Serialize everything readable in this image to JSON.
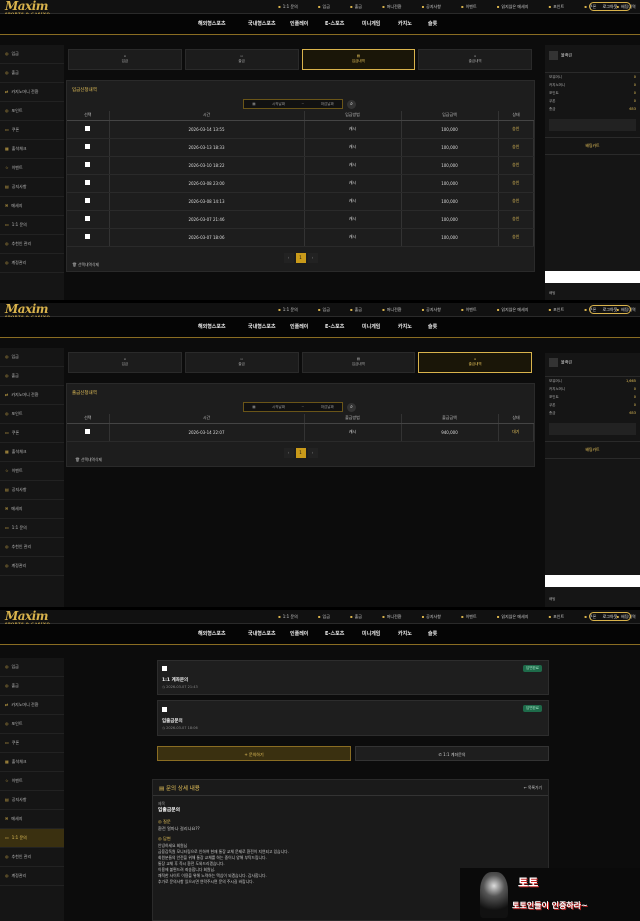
{
  "brand": {
    "name": "Maxim",
    "tagline": "SPORTS & CASINO"
  },
  "util_bar": [
    "1:1 문의",
    "입금",
    "출금",
    "머니전환",
    "공지사항",
    "이벤트",
    "읽지않은 메세지",
    "포인트",
    "쿠폰",
    "배팅내역"
  ],
  "login_label": "로그아웃",
  "nav": [
    "해외형스포츠",
    "국내형스포츠",
    "인플레이",
    "E-스포츠",
    "미니게임",
    "카지노",
    "슬롯"
  ],
  "sidebar": [
    "입금",
    "출금",
    "카지노머니 전환",
    "포인트",
    "쿠폰",
    "출석체크",
    "이벤트",
    "공지사항",
    "메세지",
    "1:1 문의",
    "추천인 관리",
    "계정관리"
  ],
  "tabs": [
    "입금",
    "출금",
    "입금내역",
    "출금내역"
  ],
  "deposit": {
    "title": "입금신청내역",
    "date_start": "시작날짜",
    "date_end": "마감날짜",
    "headers": [
      "선택",
      "시간",
      "입금방법",
      "입금금액",
      "상태"
    ],
    "rows": [
      [
        "2026-03-14 13:55",
        "캐시",
        "100,000",
        "승인"
      ],
      [
        "2026-03-13 18:33",
        "캐시",
        "100,000",
        "승인"
      ],
      [
        "2026-03-10 18:22",
        "캐시",
        "100,000",
        "승인"
      ],
      [
        "2026-03-08 23:00",
        "캐시",
        "100,000",
        "승인"
      ],
      [
        "2026-03-08 14:13",
        "캐시",
        "100,000",
        "승인"
      ],
      [
        "2026-03-07 21:46",
        "캐시",
        "100,000",
        "승인"
      ],
      [
        "2026-03-07 18:06",
        "캐시",
        "100,000",
        "승인"
      ]
    ],
    "delete_label": "선택내역삭제",
    "page": "1"
  },
  "withdraw": {
    "title": "출금신청내역",
    "date_start": "시작날짜",
    "date_end": "마감날짜",
    "headers": [
      "선택",
      "시간",
      "출금방법",
      "출금금액",
      "상태"
    ],
    "rows": [
      [
        "2026-03-14 22:07",
        "캐시",
        "940,000",
        "대기"
      ]
    ],
    "delete_label": "선택내역삭제",
    "page": "1"
  },
  "right_panel": {
    "user": "블랙린",
    "rows": [
      [
        "보유머니",
        "0"
      ],
      [
        "카지노머니",
        "0"
      ],
      [
        "포인트",
        "0"
      ],
      [
        "쿠폰",
        "0"
      ],
      [
        "총금",
        "653"
      ]
    ],
    "rows2": [
      [
        "보유머니",
        "1,665"
      ],
      [
        "카지노머니",
        "0"
      ],
      [
        "포인트",
        "0"
      ],
      [
        "쿠폰",
        "0"
      ],
      [
        "총금",
        "653"
      ]
    ],
    "bet_label": "배팅카트",
    "bottom": "배팅"
  },
  "inquiry": {
    "items": [
      {
        "title": "1:1 계좌문의",
        "date": "2026-03-07 21:43",
        "badge": "답변완료"
      },
      {
        "title": "입출금문의",
        "date": "2026-03-07 18:06",
        "badge": "답변완료"
      }
    ],
    "write_label": "+ 문의하기",
    "account_label": "1:1 계좌문의",
    "detail_title": "문의 상세 내용",
    "back_label": "목록가기",
    "subject_label": "제목",
    "subject": "입출금문의",
    "question_label": "질문",
    "question": "환전 얼마나 걸리나요??",
    "answer_label": "답변",
    "answer_lines": [
      "안녕하세요 회원님",
      "금융감독원 모니터링으로 인하여 현재 통장 교체 문제로 환전이 지연되고 있습니다.",
      "회원분들의 안전을 위해 통장 교체를 하는 중이니 양해 부탁드립니다.",
      "통장 교체 후 즉시 환전 도와드리겠습니다.",
      "이용에 불편드려 죄송합니다 회원님.",
      "쾌적한 사이트 이용을 위해 노력하는 맥심이 되겠습니다. 감사합니다.",
      "추가로 문의사항 있으시면 연락주시면 문의 주시길 바랍니다."
    ]
  },
  "watermark": {
    "line1": "토토인들이 인증하라~"
  }
}
